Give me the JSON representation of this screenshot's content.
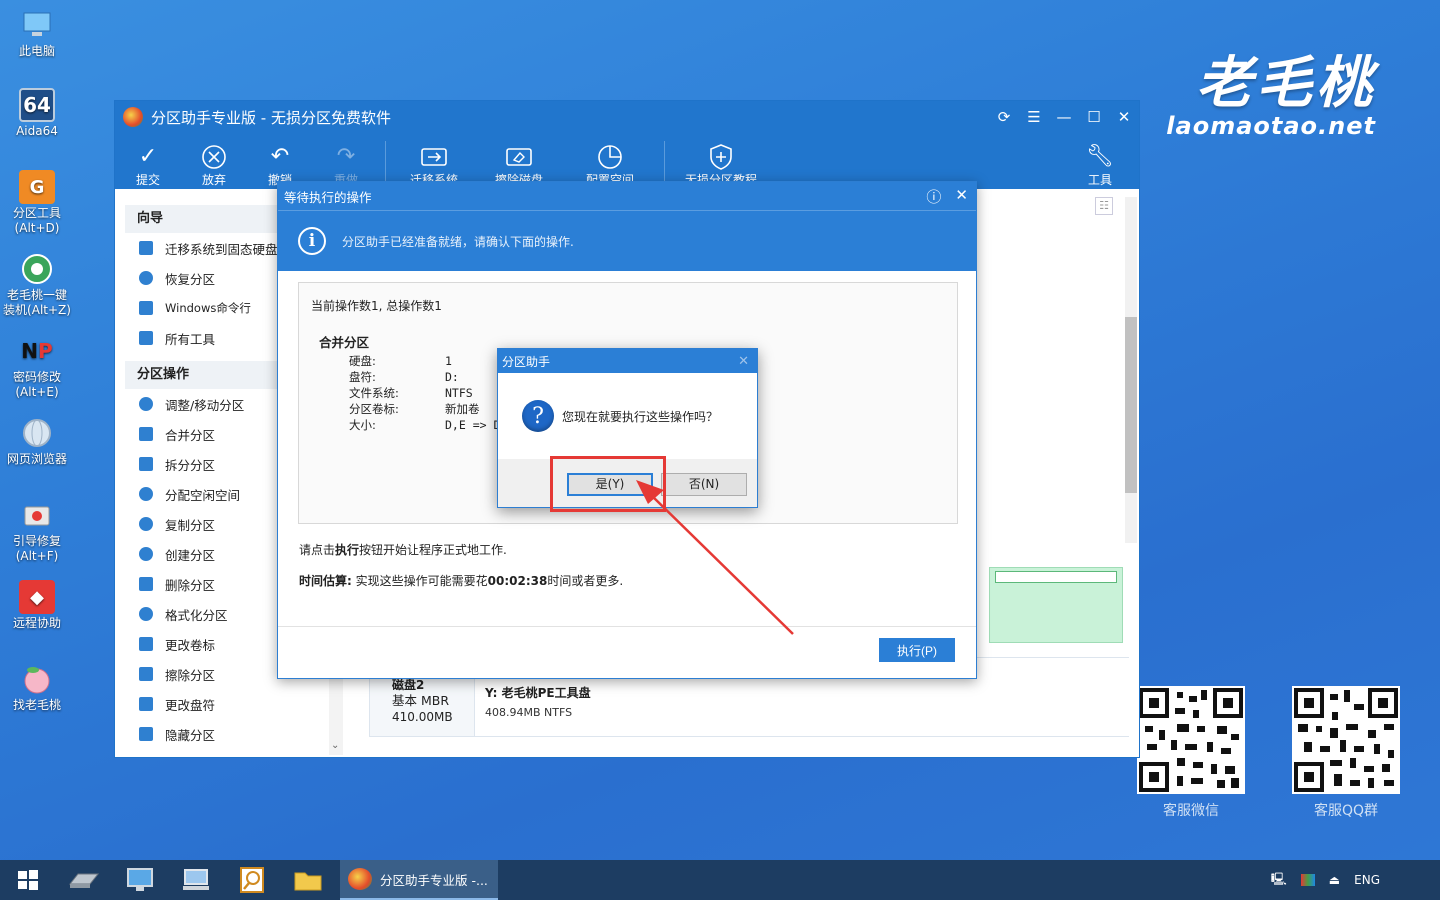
{
  "desktop": {
    "icons": [
      {
        "label": "此电脑"
      },
      {
        "label": "Aida64"
      },
      {
        "label": "分区工具\n(Alt+D)"
      },
      {
        "label": "老毛桃一键\n装机(Alt+Z)"
      },
      {
        "label": "密码修改\n(Alt+E)"
      },
      {
        "label": "网页浏览器"
      },
      {
        "label": "引导修复\n(Alt+F)"
      },
      {
        "label": "远程协助"
      },
      {
        "label": "找老毛桃"
      }
    ],
    "brand_cn": "老毛桃",
    "brand_en": "laomaotao.net",
    "qr_wechat": "客服微信",
    "qr_qq": "客服QQ群"
  },
  "window": {
    "title": "分区助手专业版 - 无损分区免费软件",
    "toolbar": [
      {
        "label": "提交"
      },
      {
        "label": "放弃"
      },
      {
        "label": "撤销"
      },
      {
        "label": "重做"
      },
      {
        "label": "迁移系统"
      },
      {
        "label": "擦除磁盘"
      },
      {
        "label": "配置空间"
      },
      {
        "label": "无损分区教程"
      },
      {
        "label": "工具"
      }
    ],
    "sidebar": {
      "wizard_header": "向导",
      "wizard_items": [
        "迁移系统到固态硬盘",
        "恢复分区",
        "Windows命令行",
        "所有工具"
      ],
      "ops_header": "分区操作",
      "ops_items": [
        "调整/移动分区",
        "合并分区",
        "拆分分区",
        "分配空闲空间",
        "复制分区",
        "创建分区",
        "删除分区",
        "格式化分区",
        "更改卷标",
        "擦除分区",
        "更改盘符",
        "隐藏分区"
      ]
    },
    "disk": {
      "name": "磁盘2",
      "type": "基本 MBR",
      "size": "410.00MB",
      "partition_label": "Y: 老毛桃PE工具盘",
      "partition_info": "408.94MB NTFS"
    }
  },
  "pending_dialog": {
    "title": "等待执行的操作",
    "info": "分区助手已经准备就绪，请确认下面的操作.",
    "counts": "当前操作数1, 总操作数1",
    "op_title": "合并分区",
    "rows": [
      {
        "k": "硬盘:",
        "v": "1"
      },
      {
        "k": "盘符:",
        "v": "D:"
      },
      {
        "k": "文件系统:",
        "v": "NTFS"
      },
      {
        "k": "分区卷标:",
        "v": "新加卷"
      },
      {
        "k": "大小:",
        "v": "D,E => D("
      }
    ],
    "note_prefix": "请点击",
    "note_bold": "执行",
    "note_suffix": "按钮开始让程序正式地工作.",
    "est_label": "时间估算:",
    "est_prefix": " 实现这些操作可能需要花",
    "est_time": "00:02:38",
    "est_suffix": "时间或者更多.",
    "execute_button": "执行(P)"
  },
  "confirm": {
    "title": "分区助手",
    "message": "您现在就要执行这些操作吗？",
    "yes": "是(Y)",
    "no": "否(N)"
  },
  "taskbar": {
    "active_task": "分区助手专业版 -...",
    "lang": "ENG"
  },
  "colors": {
    "accent": "#2b7fd6",
    "highlight": "#e53935"
  }
}
